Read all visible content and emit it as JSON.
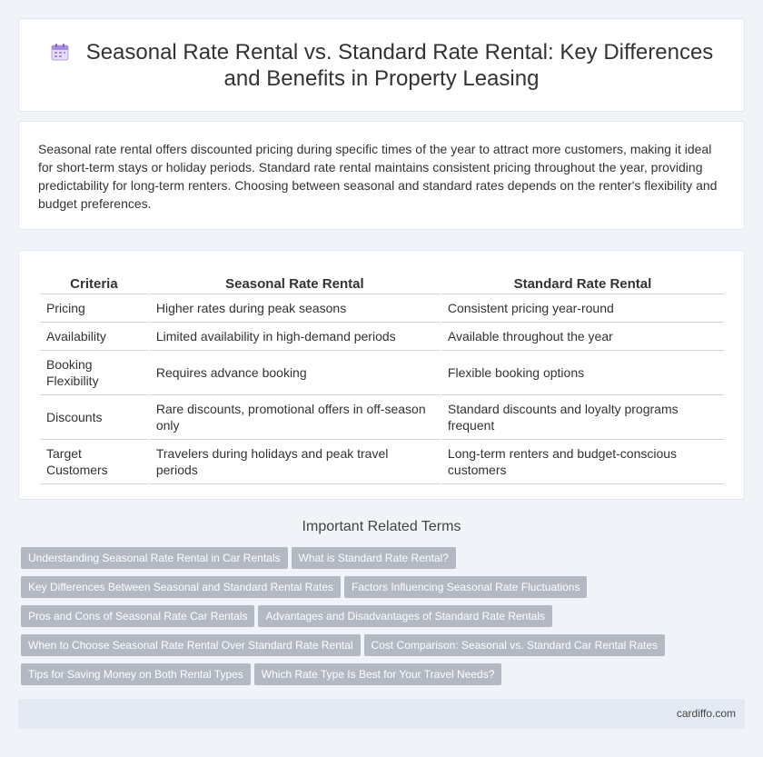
{
  "header": {
    "title_line1": "Seasonal Rate Rental vs. Standard Rate Rental: Key Differences",
    "title_line2": "and Benefits in Property Leasing",
    "icon": "calendar-icon"
  },
  "intro": {
    "text": "Seasonal rate rental offers discounted pricing during specific times of the year to attract more customers, making it ideal for short-term stays or holiday periods. Standard rate rental maintains consistent pricing throughout the year, providing predictability for long-term renters. Choosing between seasonal and standard rates depends on the renter's flexibility and budget preferences."
  },
  "table": {
    "headers": [
      "Criteria",
      "Seasonal Rate Rental",
      "Standard Rate Rental"
    ],
    "rows": [
      [
        "Pricing",
        "Higher rates during peak seasons",
        "Consistent pricing year-round"
      ],
      [
        "Availability",
        "Limited availability in high-demand periods",
        "Available throughout the year"
      ],
      [
        "Booking Flexibility",
        "Requires advance booking",
        "Flexible booking options"
      ],
      [
        "Discounts",
        "Rare discounts, promotional offers in off-season only",
        "Standard discounts and loyalty programs frequent"
      ],
      [
        "Target Customers",
        "Travelers during holidays and peak travel periods",
        "Long-term renters and budget-conscious customers"
      ]
    ]
  },
  "related": {
    "title": "Important Related Terms",
    "tags": [
      [
        "Understanding Seasonal Rate Rental in Car Rentals",
        "What is Standard Rate Rental?"
      ],
      [
        "Key Differences Between Seasonal and Standard Rental Rates",
        "Factors Influencing Seasonal Rate Fluctuations"
      ],
      [
        "Pros and Cons of Seasonal Rate Car Rentals",
        "Advantages and Disadvantages of Standard Rate Rentals"
      ],
      [
        "When to Choose Seasonal Rate Rental Over Standard Rate Rental",
        "Cost Comparison: Seasonal vs. Standard Car Rental Rates"
      ],
      [
        "Tips for Saving Money on Both Rental Types",
        "Which Rate Type Is Best for Your Travel Needs?"
      ]
    ]
  },
  "footer": {
    "site": "cardiffo.com"
  }
}
